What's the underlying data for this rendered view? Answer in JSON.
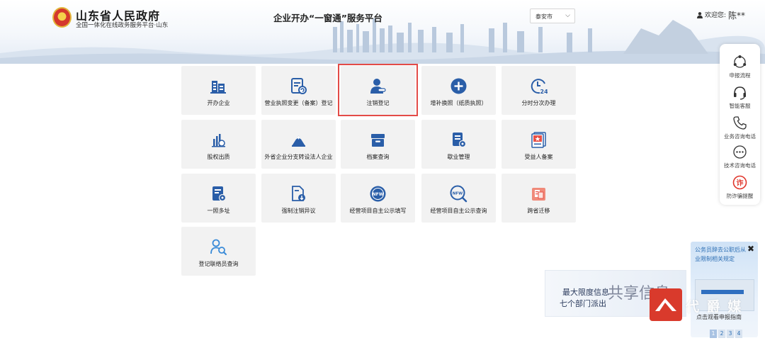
{
  "header": {
    "gov_title": "山东省人民政府",
    "gov_subtitle": "全国一体化在线政务服务平台·山东",
    "platform_title": "企业开办“一窗通”服务平台",
    "city_select": {
      "selected": "泰安市"
    },
    "user": {
      "greeting": "欢迎您:",
      "name": "陈**"
    }
  },
  "accent_color": "#2a5ea8",
  "highlight_color": "#e34b47",
  "services": [
    {
      "label": "开办企业",
      "icon": "building-icon"
    },
    {
      "label": "营业执照变更（备案）登记",
      "icon": "document-refresh-icon"
    },
    {
      "label": "注销登记",
      "icon": "user-minus-icon"
    },
    {
      "label": "增补换照（纸质执照）",
      "icon": "plus-circle-icon"
    },
    {
      "label": "分时分次办理",
      "icon": "clock-24-icon"
    },
    {
      "label": "股权出质",
      "icon": "equity-chart-icon"
    },
    {
      "label": "外省企业分支转设法人企业",
      "icon": "mountain-icon"
    },
    {
      "label": "档案查询",
      "icon": "archive-box-icon"
    },
    {
      "label": "歇业管理",
      "icon": "document-gear-icon"
    },
    {
      "label": "受益人备案",
      "icon": "star-document-icon"
    },
    {
      "label": "一照多址",
      "icon": "document-settings-icon"
    },
    {
      "label": "强制注销异议",
      "icon": "document-download-icon"
    },
    {
      "label": "经营项目自主公示填写",
      "icon": "nfw-badge-icon"
    },
    {
      "label": "经营项目自主公示查询",
      "icon": "nfw-search-icon"
    },
    {
      "label": "跨省迁移",
      "icon": "transfer-icon"
    },
    {
      "label": "登记联络员查询",
      "icon": "person-search-icon"
    }
  ],
  "float_menu": [
    {
      "label": "申报流程",
      "icon": "flow-icon"
    },
    {
      "label": "智能客服",
      "icon": "headset-icon"
    },
    {
      "label": "业务咨询电话",
      "icon": "phone-icon"
    },
    {
      "label": "技术咨询电话",
      "icon": "chat-dots-icon"
    },
    {
      "label": "防诈骗提醒",
      "icon": "anti-fraud-icon"
    }
  ],
  "notice": {
    "text": "公务员辞去公职后从业限制相关规定",
    "caption": "点击观看申报指南",
    "pages": [
      "1",
      "2",
      "3",
      "4"
    ],
    "active_page": "1"
  },
  "banner": {
    "line1": "最大限度信息",
    "line2": "七个部门派出",
    "stamp": "共享信息"
  },
  "watermark": {
    "text": "代 爵 媒"
  }
}
